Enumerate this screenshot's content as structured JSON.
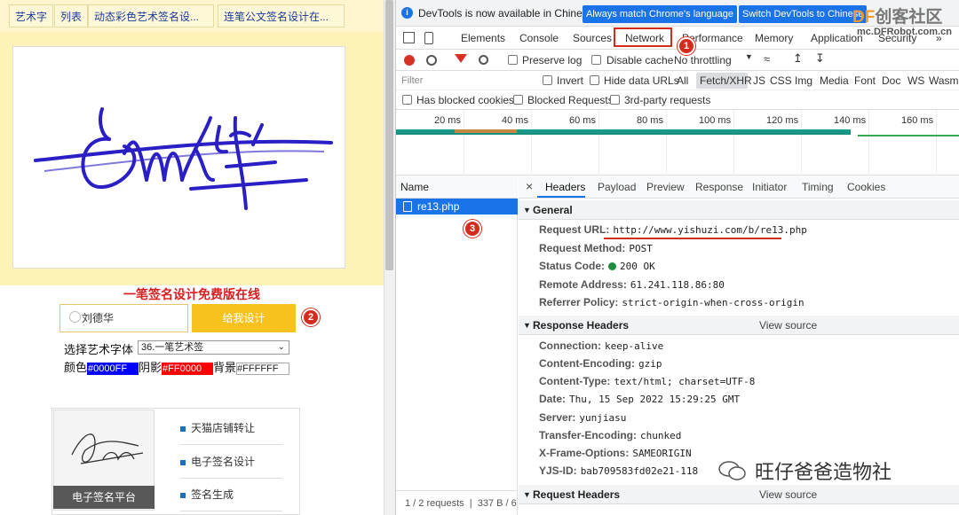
{
  "left_page": {
    "top_links": [
      "艺术字",
      "列表",
      "动态彩色艺术签名设...",
      "连笔公文签名设计在..."
    ],
    "free_title": "一笔签名设计免费版在线",
    "name_value": "刘德华",
    "generate_button": "给我设计",
    "font_label": "选择艺术字体",
    "font_select_value": "36.一笔艺术签",
    "color_label": "颜色",
    "color_value": "#0000FF",
    "shadow_label": "阴影",
    "shadow_value": "#FF0000",
    "bg_label": "背景",
    "bg_value": "#FFFFFF",
    "thumb_caption": "电子签名平台",
    "side_links": [
      "天猫店铺转让",
      "电子签名设计",
      "签名生成"
    ]
  },
  "annotations": [
    "1",
    "2",
    "3"
  ],
  "devtools": {
    "info_message": "DevTools is now available in Chinese!",
    "info_btn_match": "Always match Chrome's language",
    "info_btn_switch": "Switch DevTools to Chinese",
    "tabs": [
      "Elements",
      "Console",
      "Sources",
      "Network",
      "Performance",
      "Memory",
      "Application",
      "Security"
    ],
    "more_tabs": "»",
    "preserve_log": "Preserve log",
    "disable_cache": "Disable cache",
    "throttling": "No throttling",
    "filter_placeholder": "Filter",
    "invert": "Invert",
    "hide_data_urls": "Hide data URLs",
    "filter_types": [
      "All",
      "Fetch/XHR",
      "JS",
      "CSS",
      "Img",
      "Media",
      "Font",
      "Doc",
      "WS",
      "Wasm"
    ],
    "has_blocked_cookies": "Has blocked cookies",
    "blocked_requests": "Blocked Requests",
    "third_party": "3rd-party requests",
    "ticks": [
      "20 ms",
      "40 ms",
      "60 ms",
      "80 ms",
      "100 ms",
      "120 ms",
      "140 ms",
      "160 ms"
    ],
    "name_header": "Name",
    "request_name": "re13.php",
    "status_summary": "1 / 2 requests",
    "status_size": "337 B / 6",
    "detail_close": "×",
    "detail_tabs": [
      "Headers",
      "Payload",
      "Preview",
      "Response",
      "Initiator",
      "Timing",
      "Cookies"
    ],
    "general_title": "General",
    "general": [
      {
        "k": "Request URL:",
        "v": "http://www.yishuzi.com/b/re13.php"
      },
      {
        "k": "Request Method:",
        "v": "POST"
      },
      {
        "k": "Status Code:",
        "v": "200 OK"
      },
      {
        "k": "Remote Address:",
        "v": "61.241.118.86:80"
      },
      {
        "k": "Referrer Policy:",
        "v": "strict-origin-when-cross-origin"
      }
    ],
    "response_headers_title": "Response Headers",
    "view_source": "View source",
    "response_headers": [
      {
        "k": "Connection:",
        "v": "keep-alive"
      },
      {
        "k": "Content-Encoding:",
        "v": "gzip"
      },
      {
        "k": "Content-Type:",
        "v": "text/html; charset=UTF-8"
      },
      {
        "k": "Date:",
        "v": "Thu, 15 Sep 2022 15:29:25 GMT"
      },
      {
        "k": "Server:",
        "v": "yunjiasu"
      },
      {
        "k": "Transfer-Encoding:",
        "v": "chunked"
      },
      {
        "k": "X-Frame-Options:",
        "v": "SAMEORIGIN"
      },
      {
        "k": "YJS-ID:",
        "v": "bab709583fd02e21-118"
      }
    ],
    "request_headers_title": "Request Headers"
  },
  "watermarks": {
    "top_df": "DF",
    "top_text": "创客社区",
    "top_url": "mc.DFRobot.com.cn",
    "bottom": "旺仔爸爸造物社"
  },
  "colors": {
    "signature_stroke": "#2a1fc4",
    "color_swatch": "#0000FF",
    "shadow_swatch": "#FF0000",
    "badge": "#d42c1c",
    "accent": "#1a73e8"
  }
}
